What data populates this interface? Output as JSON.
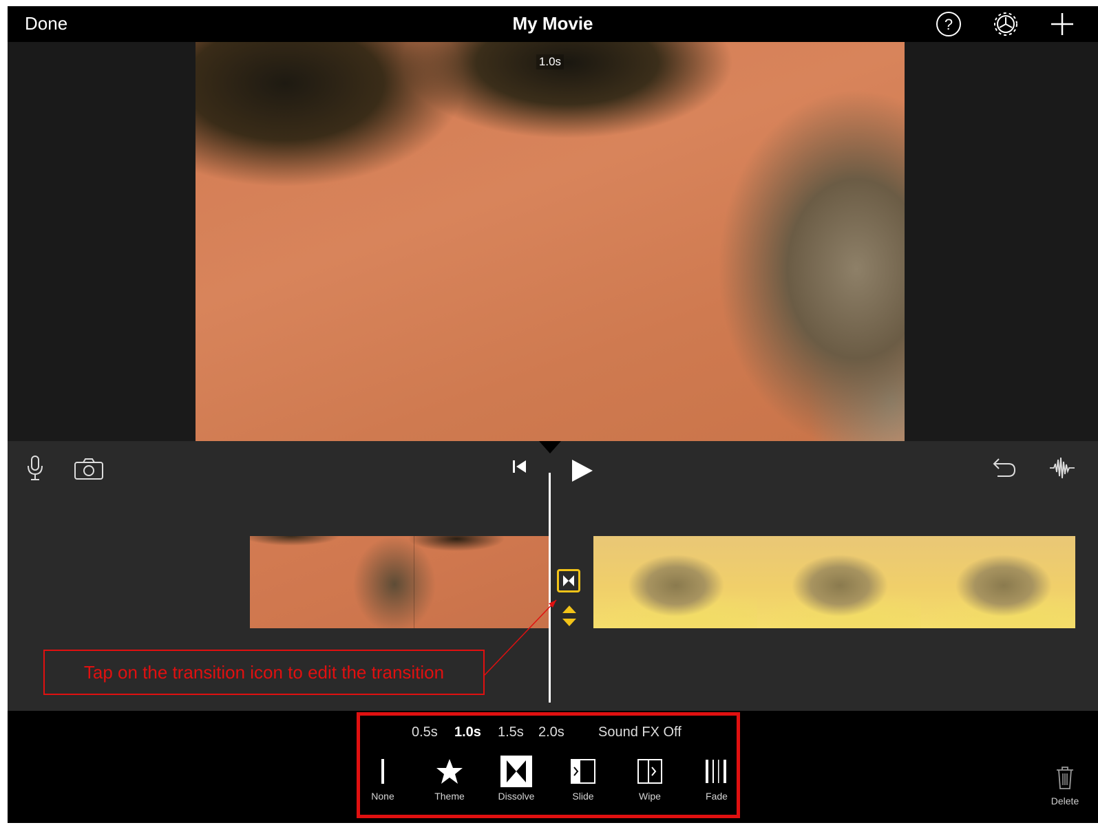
{
  "topbar": {
    "done_label": "Done",
    "title": "My Movie"
  },
  "preview": {
    "timecode": "1.0s"
  },
  "callout": {
    "text": "Tap on the transition icon to edit the transition"
  },
  "transition_panel": {
    "durations": [
      "0.5s",
      "1.0s",
      "1.5s",
      "2.0s"
    ],
    "selected_duration": "1.0s",
    "sound_fx_label": "Sound FX Off",
    "types": [
      "None",
      "Theme",
      "Dissolve",
      "Slide",
      "Wipe",
      "Fade"
    ],
    "selected_type": "Dissolve"
  },
  "delete_label": "Delete",
  "colors": {
    "accent_yellow": "#f2c318",
    "annotation_red": "#e01010"
  }
}
